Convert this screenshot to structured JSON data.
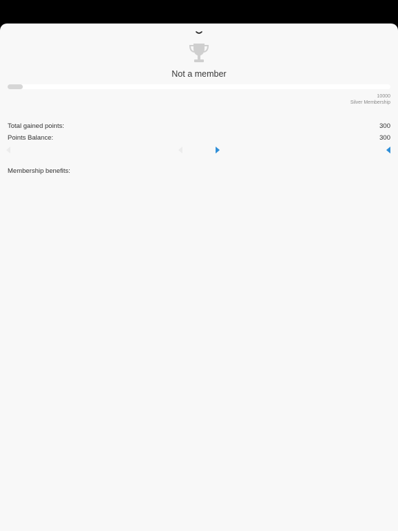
{
  "header": {
    "dismiss_icon": "chevron-down-icon",
    "trophy_icon": "trophy-icon",
    "title": "Not a member"
  },
  "progress": {
    "current_points": 300,
    "goal_points": 10000,
    "goal_value_text": "10000",
    "goal_label": "Silver Membership",
    "fill_color": "#d6d6d6",
    "track_color": "#ffffff"
  },
  "stats": {
    "total_gained_label": "Total gained points:",
    "total_gained_value": "300",
    "balance_label": "Points Balance:",
    "balance_value": "300"
  },
  "scroller": {
    "left_arrow_icon": "caret-left-icon",
    "right_arrow_icon": "caret-right-icon",
    "accent_color": "#2f8fd8",
    "faint_color": "#e8e8e8"
  },
  "benefits": {
    "label": "Membership benefits:"
  }
}
